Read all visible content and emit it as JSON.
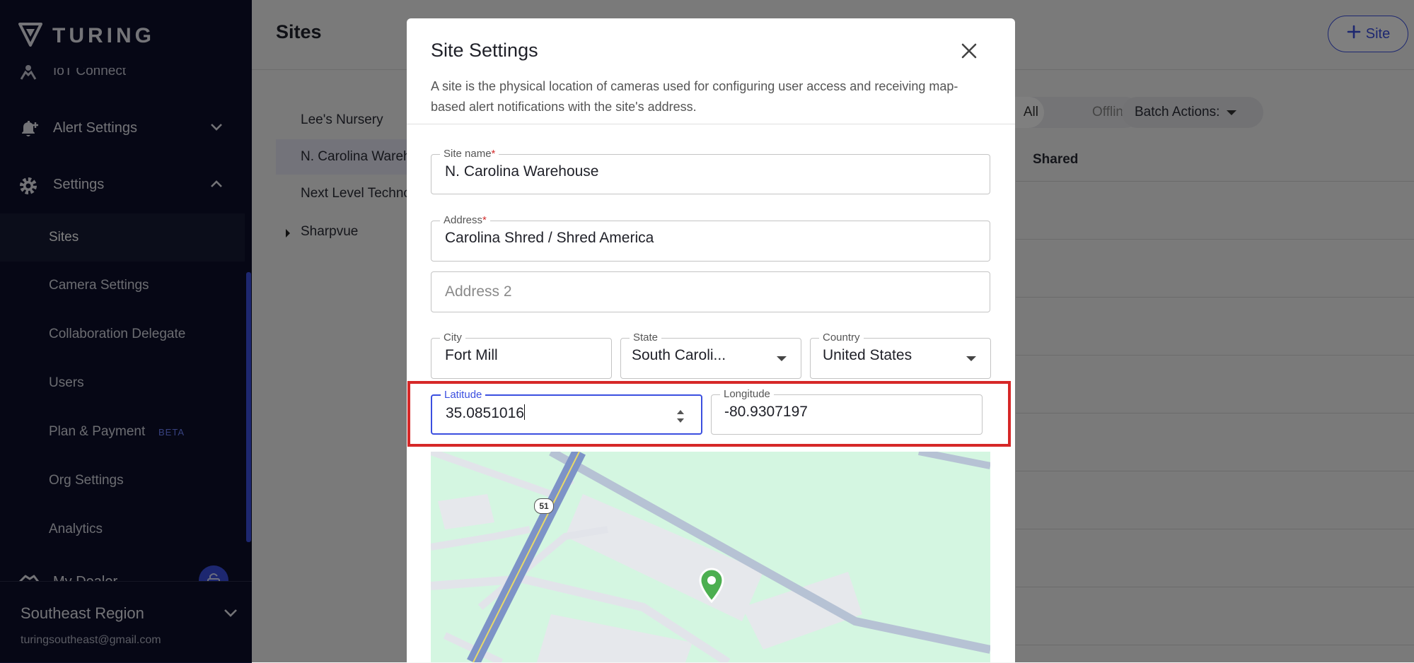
{
  "sidebar": {
    "logo_text": "TURING",
    "partial_item": "IoT Connect",
    "alert_settings": "Alert Settings",
    "settings": "Settings",
    "subitems": [
      {
        "label": "Sites"
      },
      {
        "label": "Camera Settings"
      },
      {
        "label": "Collaboration Delegate"
      },
      {
        "label": "Users"
      },
      {
        "label": "Plan & Payment",
        "badge": "BETA"
      },
      {
        "label": "Org Settings"
      },
      {
        "label": "Analytics"
      }
    ],
    "my_dealer": "My Dealer",
    "footer": {
      "region": "Southeast Region",
      "email": "turingsoutheast@gmail.com"
    }
  },
  "main": {
    "title": "Sites",
    "add_site_label": "Site",
    "sites": [
      {
        "name": "Lee's Nursery"
      },
      {
        "name": "N. Carolina Warehouse"
      },
      {
        "name": "Next Level Technologies"
      },
      {
        "name": "Sharpvue"
      }
    ],
    "toggle": {
      "all": "All",
      "offline": "Offline"
    },
    "batch_actions": "Batch Actions:",
    "column_shared": "Shared"
  },
  "modal": {
    "title": "Site Settings",
    "description": "A site is the physical location of cameras used for configuring user access and receiving map-based alert notifications with the site's address.",
    "fields": {
      "site_name": {
        "label": "Site name",
        "required": "*",
        "value": "N. Carolina Warehouse"
      },
      "address": {
        "label": "Address",
        "required": "*",
        "value": "Carolina Shred / Shred America"
      },
      "address2": {
        "placeholder": "Address 2"
      },
      "city": {
        "label": "City",
        "value": "Fort Mill"
      },
      "state": {
        "label": "State",
        "value": "South Caroli..."
      },
      "country": {
        "label": "Country",
        "value": "United States"
      },
      "latitude": {
        "label": "Latitude",
        "value": "35.0851016"
      },
      "longitude": {
        "label": "Longitude",
        "value": "-80.9307197"
      }
    },
    "map": {
      "road_shield": "51",
      "pin_color": "#4caf50"
    }
  },
  "colors": {
    "accent": "#3b4fe0",
    "sidebar_bg": "#0c0f2a",
    "highlight": "#d62828",
    "map_bg": "#d4f6e1"
  }
}
